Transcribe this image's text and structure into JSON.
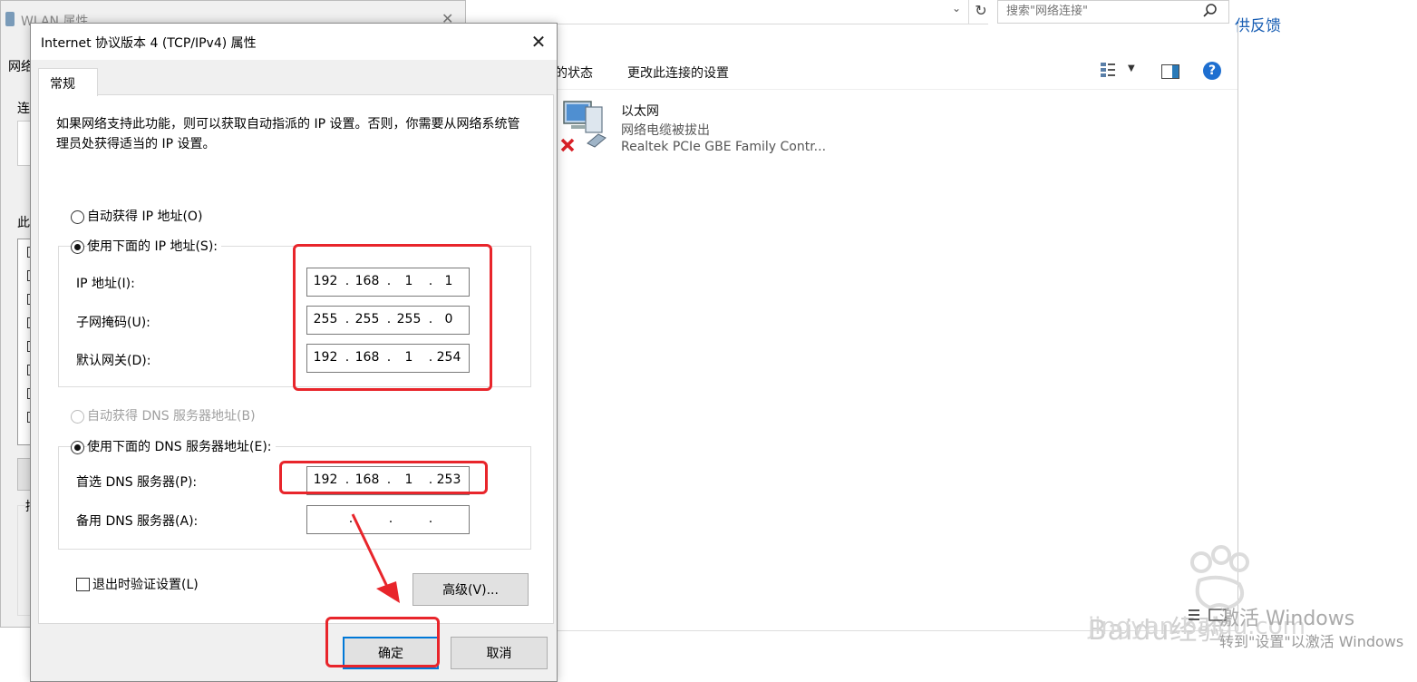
{
  "explorer": {
    "search_placeholder": "搜索\"网络连接\"",
    "feedback": "供反馈",
    "cmd_status": "的状态",
    "cmd_change": "更改此连接的设置",
    "adapter": {
      "name": "以太网",
      "status": "网络电缆被拔出",
      "device": "Realtek PCIe GBE Family Contr..."
    }
  },
  "wlan": {
    "title": "WLAN 属性",
    "tab": "网络",
    "label1": "连",
    "label2": "此",
    "bottom_label": "描"
  },
  "dialog": {
    "title": "Internet 协议版本 4 (TCP/IPv4) 属性",
    "tab": "常规",
    "description": "如果网络支持此功能，则可以获取自动指派的 IP 设置。否则，你需要从网络系统管理员处获得适当的 IP 设置。",
    "auto_ip": "自动获得 IP 地址(O)",
    "manual_ip": "使用下面的 IP 地址(S):",
    "ip_label": "IP 地址(I):",
    "mask_label": "子网掩码(U):",
    "gateway_label": "默认网关(D):",
    "ip": [
      "192",
      "168",
      "1",
      "1"
    ],
    "mask": [
      "255",
      "255",
      "255",
      "0"
    ],
    "gateway": [
      "192",
      "168",
      "1",
      "254"
    ],
    "auto_dns": "自动获得 DNS 服务器地址(B)",
    "manual_dns": "使用下面的 DNS 服务器地址(E):",
    "pref_dns_label": "首选 DNS 服务器(P):",
    "alt_dns_label": "备用 DNS 服务器(A):",
    "pref_dns": [
      "192",
      "168",
      "1",
      "253"
    ],
    "alt_dns": [
      "",
      "",
      "",
      ""
    ],
    "validate_label": "退出时验证设置(L)",
    "advanced": "高级(V)...",
    "ok": "确定",
    "cancel": "取消"
  },
  "overlay": {
    "activate_title": "激活 Windows",
    "activate_sub": "转到\"设置\"以激活 Windows",
    "watermark": "Baidu经验",
    "watermark_sub": "jingyan.baidu.com"
  }
}
